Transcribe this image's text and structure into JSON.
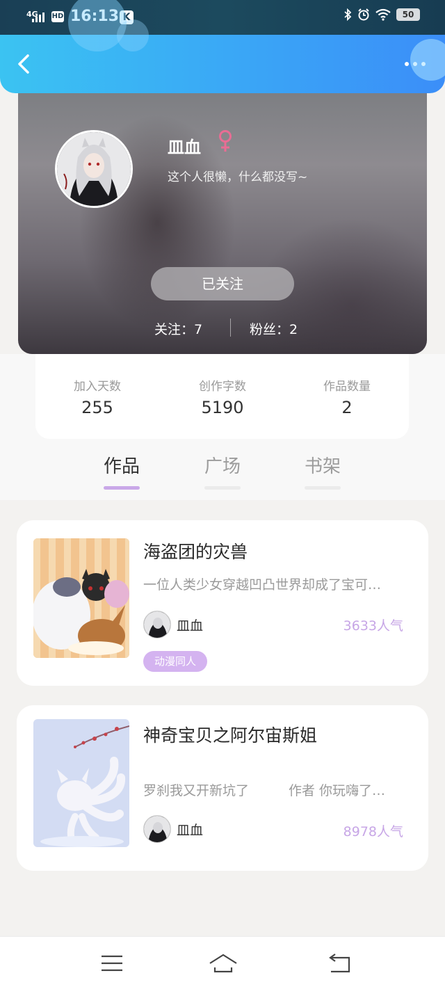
{
  "status_bar": {
    "signal": "4G",
    "hd": "HD",
    "time": "16:13",
    "app_badge": "K",
    "battery": "50"
  },
  "header": {
    "back_icon": "chevron-left-icon",
    "more_icon": "more-horizontal-icon"
  },
  "profile": {
    "username": "皿血",
    "gender_symbol": "♀",
    "gender_color": "#e96d94",
    "bio": "这个人很懒，什么都没写~",
    "follow_button": "已关注",
    "following_text": "关注：7",
    "fans_text": "粉丝：2"
  },
  "stats": [
    {
      "label": "加入天数",
      "value": "255"
    },
    {
      "label": "创作字数",
      "value": "5190"
    },
    {
      "label": "作品数量",
      "value": "2"
    }
  ],
  "tabs": [
    {
      "label": "作品",
      "active": true
    },
    {
      "label": "广场",
      "active": false
    },
    {
      "label": "书架",
      "active": false
    }
  ],
  "works": [
    {
      "title": "海盗团的灾兽",
      "description": "一位人类少女穿越凹凸世界却成了宝可…",
      "author": "皿血",
      "popularity": "3633人气",
      "tag": "动漫同人"
    },
    {
      "title": "神奇宝贝之阿尔宙斯姐",
      "description": "罗刹我又开新坑了　　　作者 你玩嗨了…",
      "author": "皿血",
      "popularity": "8978人气",
      "tag": ""
    }
  ],
  "colors": {
    "header_gradient_start": "#3bc3f2",
    "header_gradient_end": "#3b8ef8",
    "accent_purple": "#c9a8e8",
    "popularity_purple": "#c7a6e6",
    "tag_purple": "#d4b3f0"
  }
}
